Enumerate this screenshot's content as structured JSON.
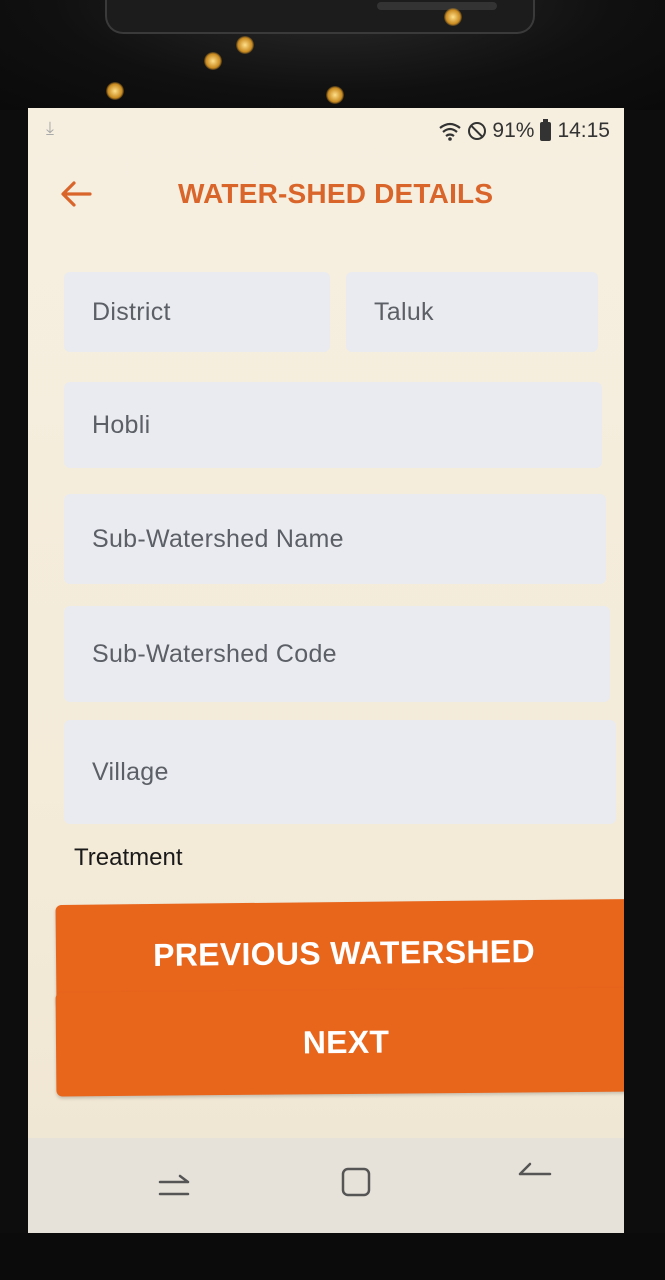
{
  "status_bar": {
    "battery": "91%",
    "time": "14:15",
    "icons": [
      "download-icon",
      "wifi-icon",
      "do-not-disturb-icon",
      "battery-icon"
    ]
  },
  "app_bar": {
    "title": "WATER-SHED DETAILS",
    "back_icon": "arrow-left-icon",
    "accent_color": "#d9652a"
  },
  "form": {
    "district_placeholder": "District",
    "taluk_placeholder": "Taluk",
    "hobli_placeholder": "Hobli",
    "sub_watershed_name_placeholder": "Sub-Watershed Name",
    "sub_watershed_code_placeholder": "Sub-Watershed Code",
    "village_placeholder": "Village",
    "treatment_label": "Treatment"
  },
  "buttons": {
    "previous_label": "PREVIOUS WATERSHED",
    "next_label": "NEXT",
    "color": "#e8651c"
  },
  "nav_bar": {
    "icons": [
      "recent-apps-icon",
      "home-icon",
      "back-icon"
    ]
  }
}
